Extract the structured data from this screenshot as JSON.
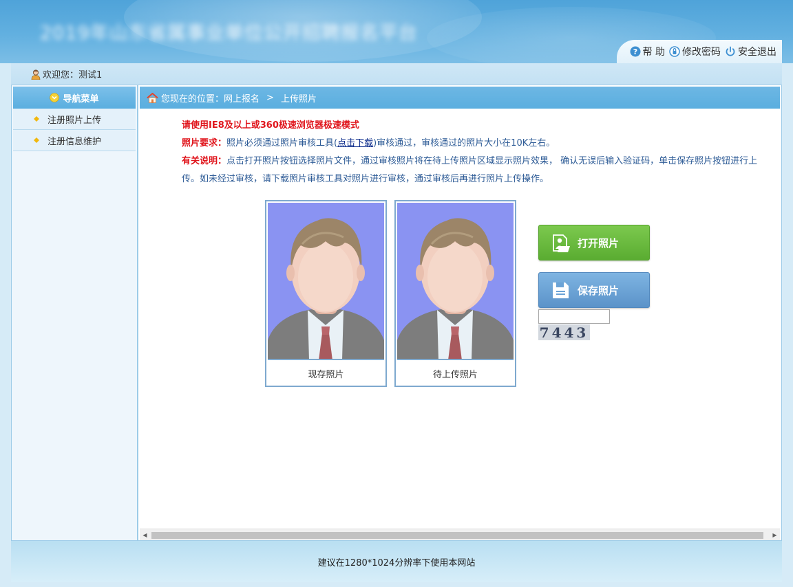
{
  "header": {
    "site_title": "2019年山东省属事业单位公开招聘报名平台",
    "toolbar": {
      "help_label": "帮 助",
      "change_password_label": "修改密码",
      "logout_label": "安全退出"
    }
  },
  "welcome": {
    "text": "欢迎您：测试1"
  },
  "sidebar": {
    "title": "导航菜单",
    "items": [
      {
        "label": "注册照片上传"
      },
      {
        "label": "注册信息维护"
      }
    ]
  },
  "breadcrumb": {
    "prefix": "您现在的位置：",
    "path": [
      "网上报名",
      "上传照片"
    ],
    "separator": ">"
  },
  "notes": {
    "browser_notice": "请使用IE8及以上或360极速浏览器极速模式",
    "req_label": "照片要求：",
    "req_text_before": "照片必须通过照片审核工具(",
    "req_link": "点击下载",
    "req_text_after": ")审核通过，审核通过的照片大小在10K左右。",
    "desc_label": "有关说明：",
    "desc_text": "点击打开照片按钮选择照片文件，通过审核照片将在待上传照片区域显示照片效果， 确认无误后输入验证码，单击保存照片按钮进行上传。如未经过审核，请下载照片审核工具对照片进行审核，通过审核后再进行照片上传操作。"
  },
  "photos": {
    "current_caption": "现存照片",
    "pending_caption": "待上传照片"
  },
  "actions": {
    "open_label": "打开照片",
    "save_label": "保存照片",
    "captcha_value": "",
    "captcha_code": "7443"
  },
  "footer": {
    "text": "建议在1280*1024分辨率下使用本网站"
  },
  "colors": {
    "header_blue": "#5aaedf",
    "alert_red": "#e0141b",
    "text_blue": "#2d5b96",
    "open_green": "#5aac31",
    "save_blue": "#5b93c9",
    "photo_bg": "#8a93f2"
  }
}
